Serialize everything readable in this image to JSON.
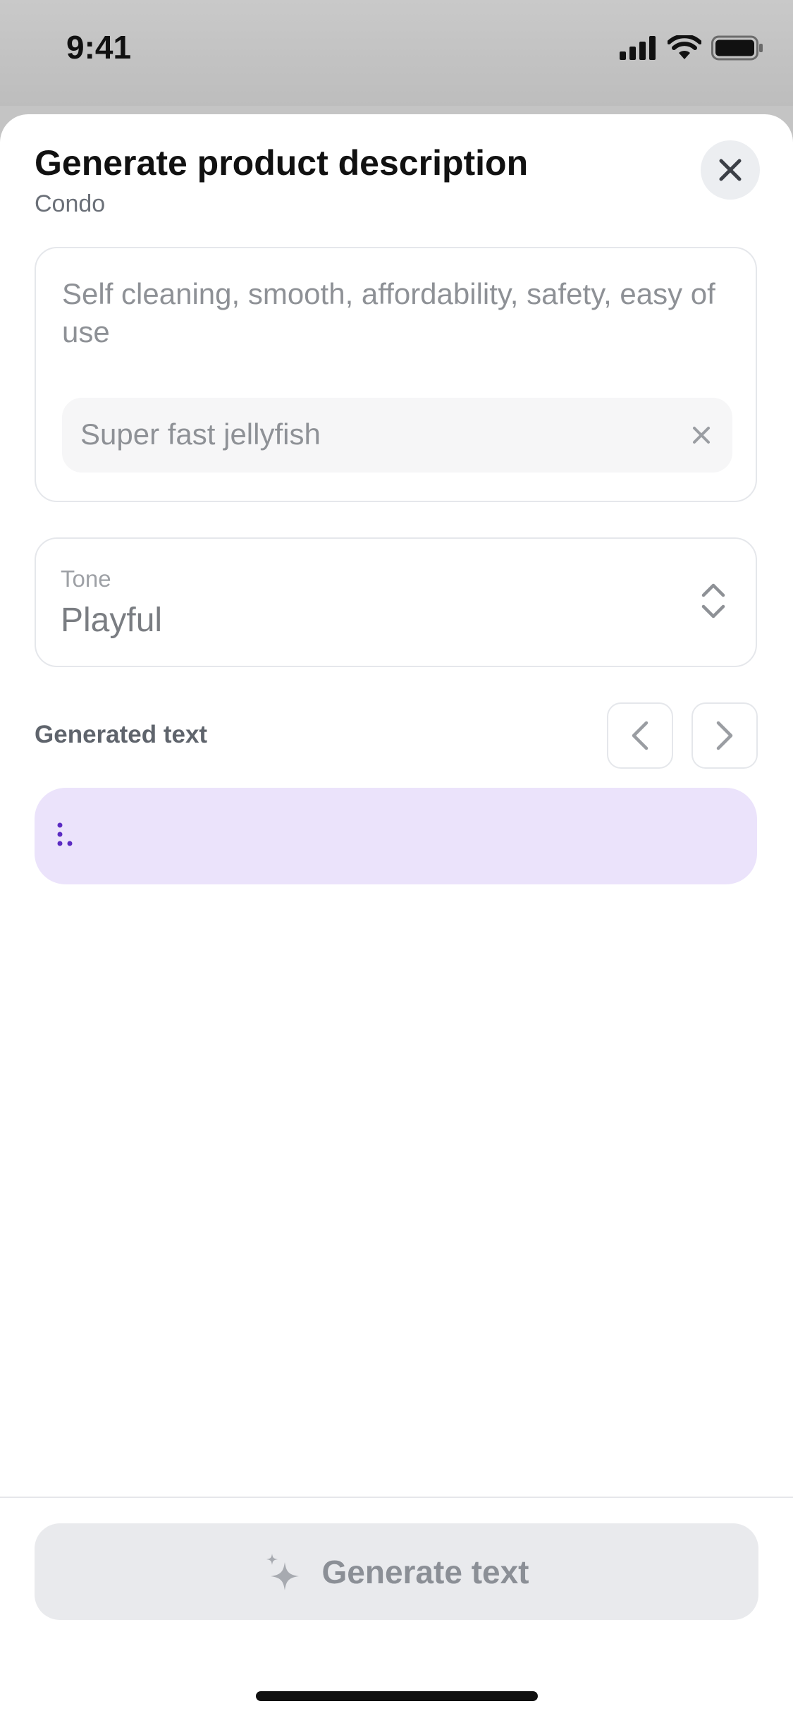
{
  "status_bar": {
    "time": "9:41"
  },
  "header": {
    "title": "Generate product description",
    "subtitle": "Condo",
    "close_icon": "close-icon"
  },
  "input_card": {
    "keywords": "Self cleaning, smooth, affordability, safety, easy of use",
    "product_name": "Super fast jellyfish"
  },
  "tone": {
    "label": "Tone",
    "value": "Playful"
  },
  "generated": {
    "label": "Generated text",
    "prev_icon": "chevron-left-icon",
    "next_icon": "chevron-right-icon",
    "loading_color": "#5b2bc2"
  },
  "footer": {
    "generate_label": "Generate text",
    "icon": "sparkles-icon"
  },
  "colors": {
    "generated_bg": "#ebe3fb",
    "button_bg": "#e9eaed"
  }
}
